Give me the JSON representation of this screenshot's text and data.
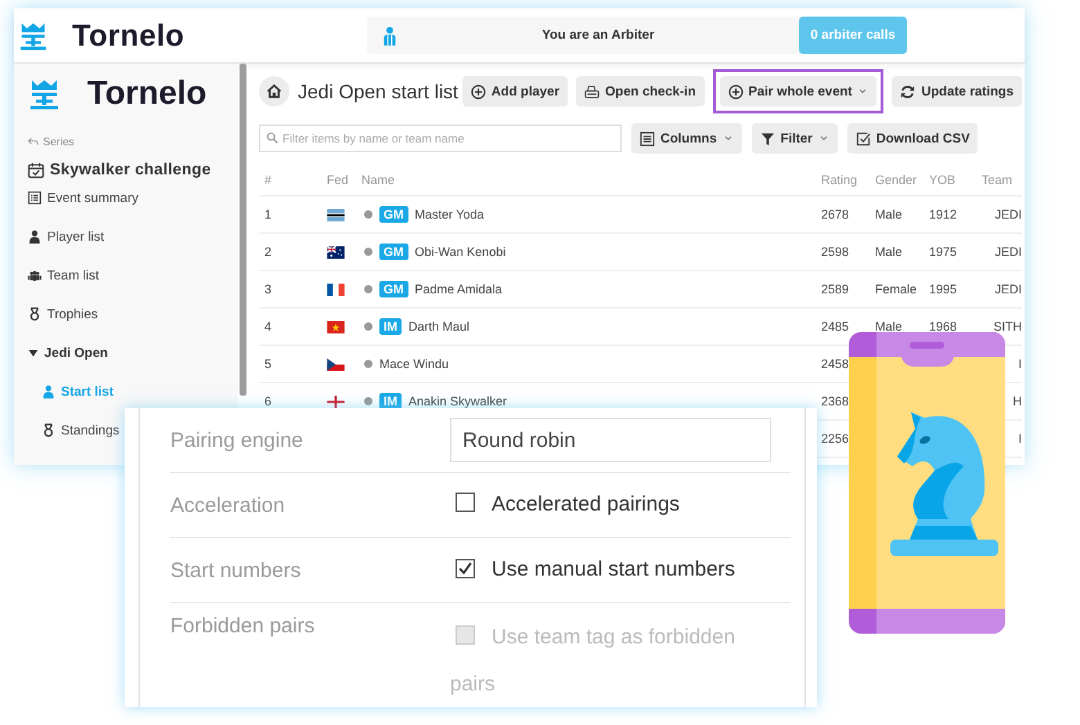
{
  "header": {
    "logo": "Tornelo",
    "role_banner": "You are an Arbiter",
    "calls_button": "0 arbiter calls"
  },
  "sidebar": {
    "logo": "Tornelo",
    "back_link": "Series",
    "event_title": "Skywalker challenge",
    "items": [
      {
        "label": "Event summary",
        "selected": false
      },
      {
        "label": "Player list",
        "selected": false
      },
      {
        "label": "Team list",
        "selected": false
      },
      {
        "label": "Trophies",
        "selected": false
      },
      {
        "label": "Jedi Open",
        "selected": false,
        "expanded": true,
        "children": [
          {
            "label": "Start list",
            "selected": true
          },
          {
            "label": "Standings",
            "selected": false
          }
        ]
      }
    ]
  },
  "content": {
    "title": "Jedi Open start list",
    "toolbar": [
      {
        "label": "Add player",
        "dropdown": false,
        "highlighted": false
      },
      {
        "label": "Open check-in",
        "dropdown": false,
        "highlighted": false
      },
      {
        "label": "Pair whole event",
        "dropdown": true,
        "highlighted": true
      },
      {
        "label": "Update ratings",
        "dropdown": false,
        "highlighted": false
      }
    ],
    "search": {
      "placeholder": "Filter items by name or team name"
    },
    "table_tools": [
      {
        "label": "Columns",
        "dropdown": true
      },
      {
        "label": "Filter",
        "dropdown": true
      },
      {
        "label": "Download CSV",
        "dropdown": false
      }
    ],
    "table": {
      "columns": [
        "#",
        "Fed",
        "Name",
        "Rating",
        "Gender",
        "YOB",
        "Team"
      ],
      "rows": [
        {
          "number": "1",
          "flag": {
            "kind": "botswana"
          },
          "title": "GM",
          "name": "Master Yoda",
          "rating": "2678",
          "gender": "Male",
          "yob": "1912",
          "team": "JEDI"
        },
        {
          "number": "2",
          "flag": {
            "kind": "australia"
          },
          "title": "GM",
          "name": "Obi-Wan Kenobi",
          "rating": "2598",
          "gender": "Male",
          "yob": "1975",
          "team": "JEDI"
        },
        {
          "number": "3",
          "flag": {
            "kind": "france"
          },
          "title": "GM",
          "name": "Padme Amidala",
          "rating": "2589",
          "gender": "Female",
          "yob": "1995",
          "team": "JEDI"
        },
        {
          "number": "4",
          "flag": {
            "kind": "vietnam"
          },
          "title": "IM",
          "name": "Darth Maul",
          "rating": "2485",
          "gender": "Male",
          "yob": "1968",
          "team": "SITH"
        },
        {
          "number": "5",
          "flag": {
            "kind": "czechia"
          },
          "name": "Mace Windu",
          "rating": "2458",
          "team": "I"
        },
        {
          "number": "6",
          "flag": {
            "kind": "england"
          },
          "title": "IM",
          "name": "Anakin Skywalker",
          "rating": "2368",
          "team": "H"
        },
        {
          "rating": "2256",
          "team": "I"
        }
      ]
    }
  },
  "settings": {
    "rows": [
      {
        "kind": "text",
        "label": "Pairing engine",
        "value": "Round robin"
      },
      {
        "kind": "checkbox",
        "label": "Acceleration",
        "option": "Accelerated pairings",
        "checked": false,
        "disabled": false
      },
      {
        "kind": "checkbox",
        "label": "Start numbers",
        "option": "Use manual start numbers",
        "checked": true,
        "disabled": false
      },
      {
        "kind": "checkbox",
        "label": "Forbidden pairs",
        "option": "Use team tag as forbidden pairs",
        "checked": false,
        "disabled": true
      }
    ]
  }
}
